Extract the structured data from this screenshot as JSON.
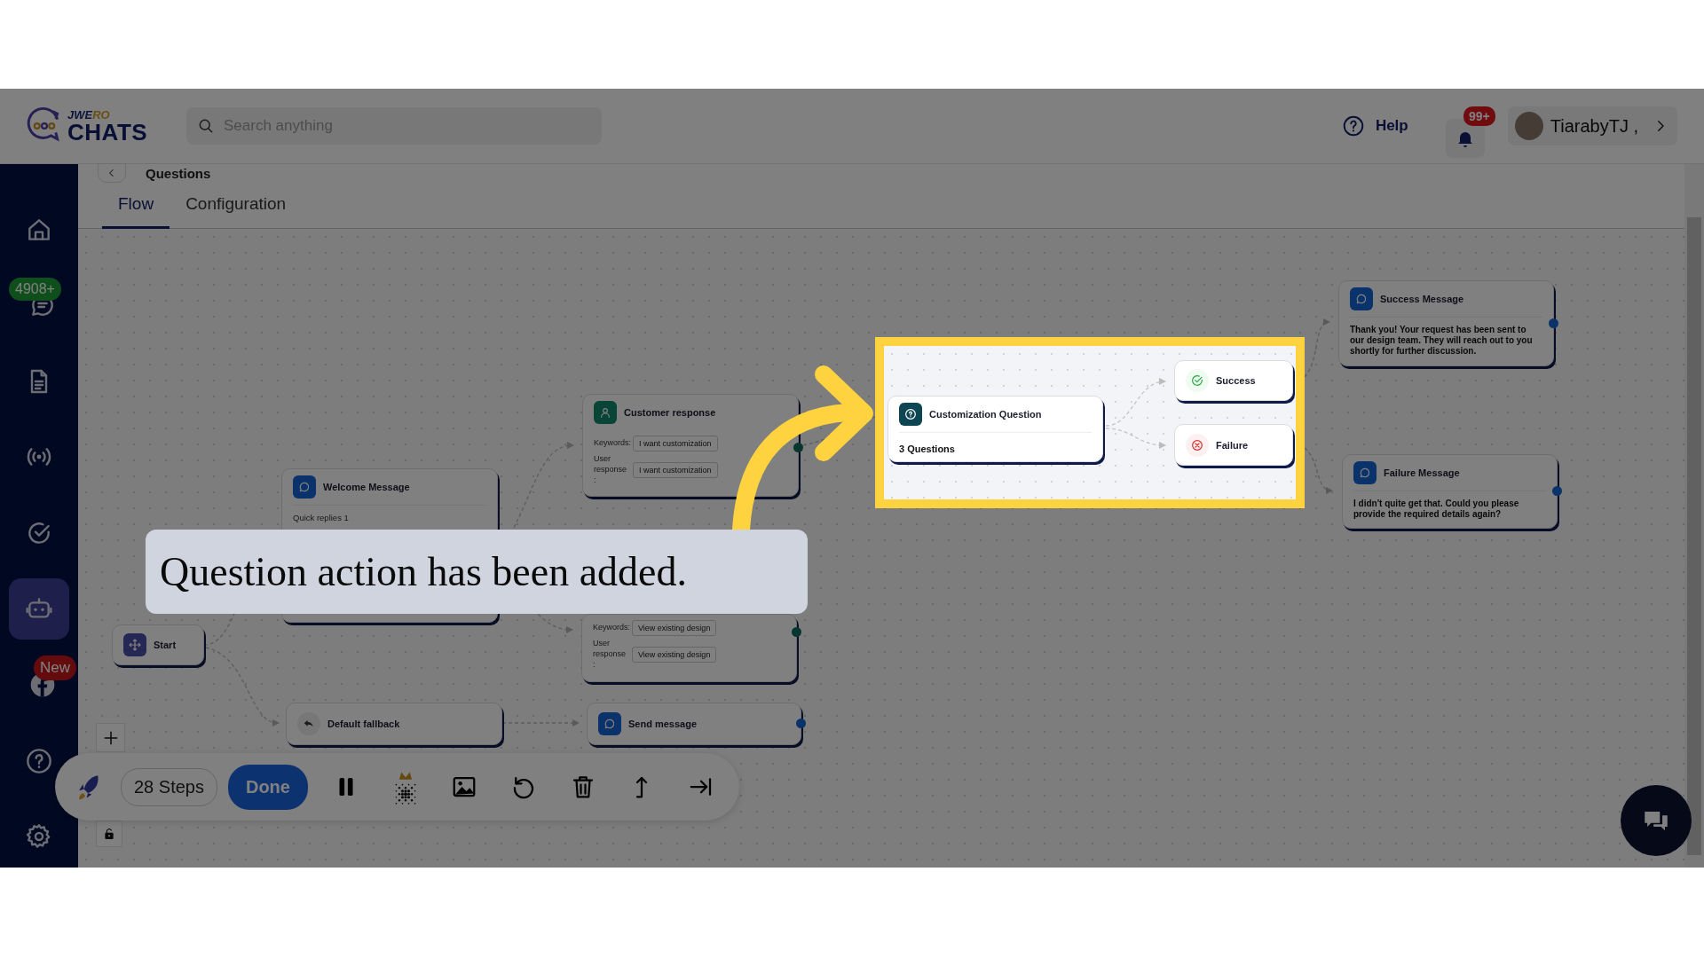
{
  "header": {
    "logo": {
      "top": "JWERO",
      "bottom": "CHATS"
    },
    "search": {
      "placeholder": "Search anything"
    },
    "help": "Help",
    "notifications": "99+",
    "user": "TiarabyTJ ,"
  },
  "page": {
    "title": "Questions"
  },
  "tabs": [
    {
      "label": "Flow",
      "selected": true
    },
    {
      "label": "Configuration",
      "selected": false
    }
  ],
  "sidebar": {
    "items": [
      {
        "selected": false
      },
      {
        "selected": false,
        "badge": {
          "text": "4908+",
          "color": "#0f4f1b"
        }
      },
      {
        "selected": false
      },
      {
        "selected": false
      },
      {
        "selected": false
      },
      {
        "selected": true
      },
      {
        "selected": false,
        "badge": {
          "text": "New",
          "color": "#640b0e"
        }
      },
      {
        "selected": false
      },
      {
        "selected": false
      }
    ]
  },
  "canvas": {
    "nodes": [
      {
        "kind": "start",
        "title": "Start"
      },
      {
        "kind": "message",
        "title": "Welcome Message",
        "subtitle": "Quick replies 1"
      },
      {
        "kind": "response",
        "title": "Customer response",
        "keywords_label": "Keywords:",
        "keyword": "I want customization",
        "response_label": "User response :",
        "response": "I want customization"
      },
      {
        "kind": "response",
        "keywords_label": "Keywords:",
        "keyword": "View existing design",
        "response_label": "User response :",
        "response": "View existing design"
      },
      {
        "kind": "fallback",
        "title": "Default fallback"
      },
      {
        "kind": "message",
        "title": "Send message"
      },
      {
        "kind": "message",
        "title": "Success Message",
        "body": "Thank you! Your request has been sent to our design team. They will reach out to you shortly for further discussion."
      },
      {
        "kind": "message",
        "title": "Failure Message",
        "body": "I didn't quite get that. Could you please provide the required details again?"
      }
    ]
  },
  "highlight": {
    "nodes": [
      {
        "kind": "question",
        "title": "Customization Question",
        "body": "3 Questions"
      },
      {
        "kind": "success",
        "title": "Success"
      },
      {
        "kind": "failure",
        "title": "Failure"
      }
    ]
  },
  "caption": "Question action has been added.",
  "toolbar": {
    "steps": "28 Steps",
    "done": "Done"
  }
}
